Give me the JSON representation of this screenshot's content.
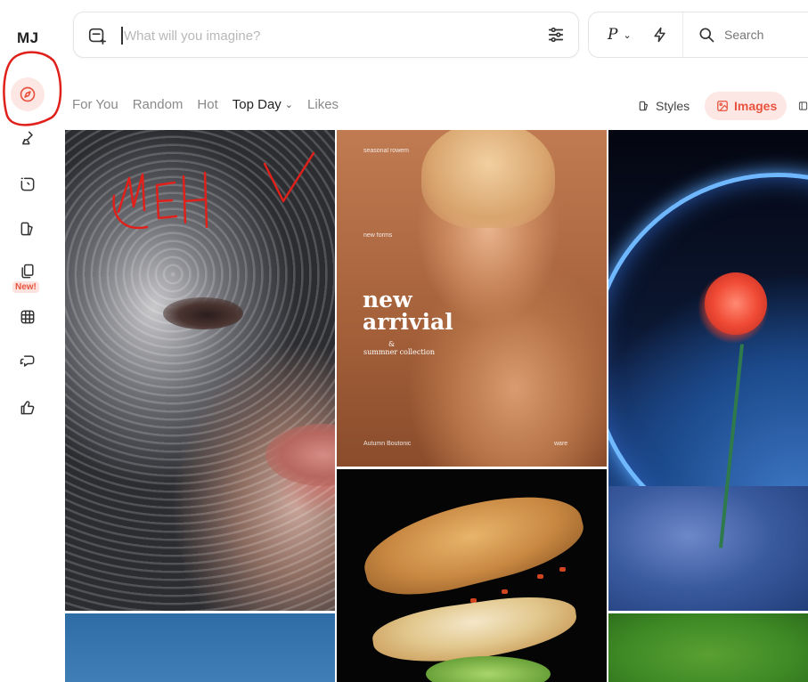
{
  "sidebar": {
    "logo": "MJ",
    "new_badge": "New!",
    "items": [
      {
        "name": "explore",
        "icon": "compass-icon",
        "active": true
      },
      {
        "name": "create",
        "icon": "brush-icon"
      },
      {
        "name": "edit",
        "icon": "edit-frame-icon"
      },
      {
        "name": "personalize",
        "icon": "palette-icon"
      },
      {
        "name": "moodboards",
        "icon": "cards-icon"
      },
      {
        "name": "organize",
        "icon": "grid-icon"
      },
      {
        "name": "chat",
        "icon": "chat-icon"
      },
      {
        "name": "likes",
        "icon": "thumbs-up-icon"
      }
    ]
  },
  "prompt": {
    "placeholder": "What will you imagine?",
    "add_icon": "image-add-icon",
    "settings_icon": "sliders-icon"
  },
  "tools": {
    "personalize_label": "P",
    "speed_icon": "bolt-icon",
    "search_label": "Search"
  },
  "filters": {
    "tabs": [
      {
        "label": "For You",
        "active": false
      },
      {
        "label": "Random",
        "active": false
      },
      {
        "label": "Hot",
        "active": false
      },
      {
        "label": "Top Day",
        "active": true
      },
      {
        "label": "Likes",
        "active": false
      }
    ]
  },
  "views": {
    "styles_label": "Styles",
    "images_label": "Images"
  },
  "poster": {
    "brand": "seasonal rowem",
    "kicker": "new forms",
    "headline_1": "new",
    "headline_2": "arrivial",
    "amp": "&",
    "sub": "summner collection",
    "footer_left": "Autumn Boutonic",
    "footer_right": "ware"
  },
  "annotations": {
    "text": "MEH",
    "color": "#e0201a"
  },
  "colors": {
    "accent": "#e8533f",
    "accent_bg": "#fde7e4"
  }
}
